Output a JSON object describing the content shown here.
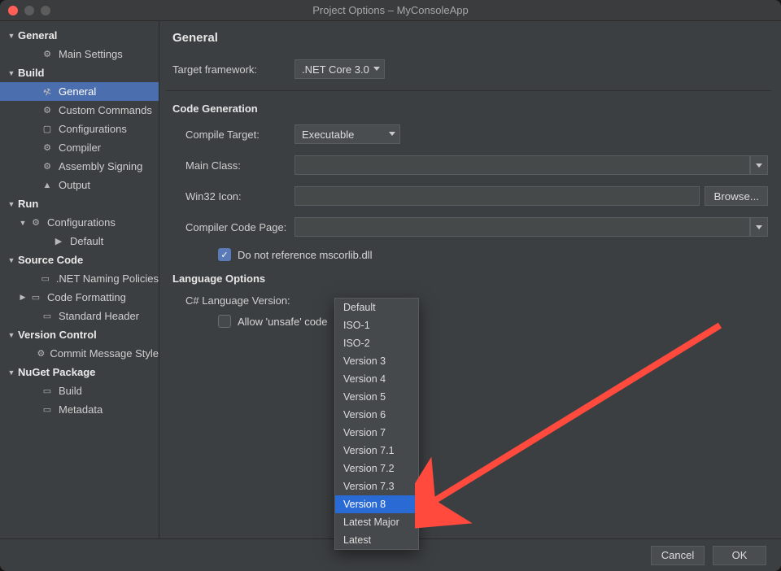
{
  "window": {
    "title": "Project Options – MyConsoleApp"
  },
  "sidebar": {
    "items": [
      {
        "label": "General",
        "kind": "section",
        "arrow": "▼",
        "indent": 0
      },
      {
        "label": "Main Settings",
        "kind": "item",
        "icon": "gear",
        "indent": 2
      },
      {
        "label": "Build",
        "kind": "section",
        "arrow": "▼",
        "indent": 0
      },
      {
        "label": "General",
        "kind": "item",
        "icon": "hammer",
        "indent": 2,
        "selected": true
      },
      {
        "label": "Custom Commands",
        "kind": "item",
        "icon": "gear",
        "indent": 2
      },
      {
        "label": "Configurations",
        "kind": "item",
        "icon": "box",
        "indent": 2
      },
      {
        "label": "Compiler",
        "kind": "item",
        "icon": "gear",
        "indent": 2
      },
      {
        "label": "Assembly Signing",
        "kind": "item",
        "icon": "gear",
        "indent": 2
      },
      {
        "label": "Output",
        "kind": "item",
        "icon": "output",
        "indent": 2
      },
      {
        "label": "Run",
        "kind": "section",
        "arrow": "▼",
        "indent": 0
      },
      {
        "label": "Configurations",
        "kind": "sub",
        "arrow": "▼",
        "icon": "gear",
        "indent": 1
      },
      {
        "label": "Default",
        "kind": "item",
        "icon": "play",
        "indent": 3
      },
      {
        "label": "Source Code",
        "kind": "section",
        "arrow": "▼",
        "indent": 0
      },
      {
        "label": ".NET Naming Policies",
        "kind": "item",
        "icon": "doc",
        "indent": 2
      },
      {
        "label": "Code Formatting",
        "kind": "item",
        "arrow": "▶",
        "icon": "doc",
        "indent": 1
      },
      {
        "label": "Standard Header",
        "kind": "item",
        "icon": "doc",
        "indent": 2
      },
      {
        "label": "Version Control",
        "kind": "section",
        "arrow": "▼",
        "indent": 0
      },
      {
        "label": "Commit Message Style",
        "kind": "item",
        "icon": "gear",
        "indent": 2
      },
      {
        "label": "NuGet Package",
        "kind": "section",
        "arrow": "▼",
        "indent": 0
      },
      {
        "label": "Build",
        "kind": "item",
        "icon": "doc",
        "indent": 2
      },
      {
        "label": "Metadata",
        "kind": "item",
        "icon": "doc",
        "indent": 2
      }
    ]
  },
  "content": {
    "title": "General",
    "target_framework_label": "Target framework:",
    "target_framework_value": ".NET Core 3.0",
    "code_generation_header": "Code Generation",
    "compile_target_label": "Compile Target:",
    "compile_target_value": "Executable",
    "main_class_label": "Main Class:",
    "main_class_value": "",
    "win32_icon_label": "Win32 Icon:",
    "win32_icon_value": "",
    "browse_label": "Browse...",
    "compiler_code_page_label": "Compiler Code Page:",
    "compiler_code_page_value": "",
    "mscorlib_label": "Do not reference mscorlib.dll",
    "mscorlib_checked": true,
    "language_options_header": "Language Options",
    "csharp_lang_version_label": "C# Language Version:",
    "allow_unsafe_label": "Allow 'unsafe' code",
    "allow_unsafe_checked": false
  },
  "lang_dropdown": {
    "options": [
      "Default",
      "ISO-1",
      "ISO-2",
      "Version 3",
      "Version 4",
      "Version 5",
      "Version 6",
      "Version 7",
      "Version 7.1",
      "Version 7.2",
      "Version 7.3",
      "Version 8",
      "Latest Major",
      "Latest"
    ],
    "selected": "Version 8"
  },
  "footer": {
    "cancel": "Cancel",
    "ok": "OK"
  }
}
